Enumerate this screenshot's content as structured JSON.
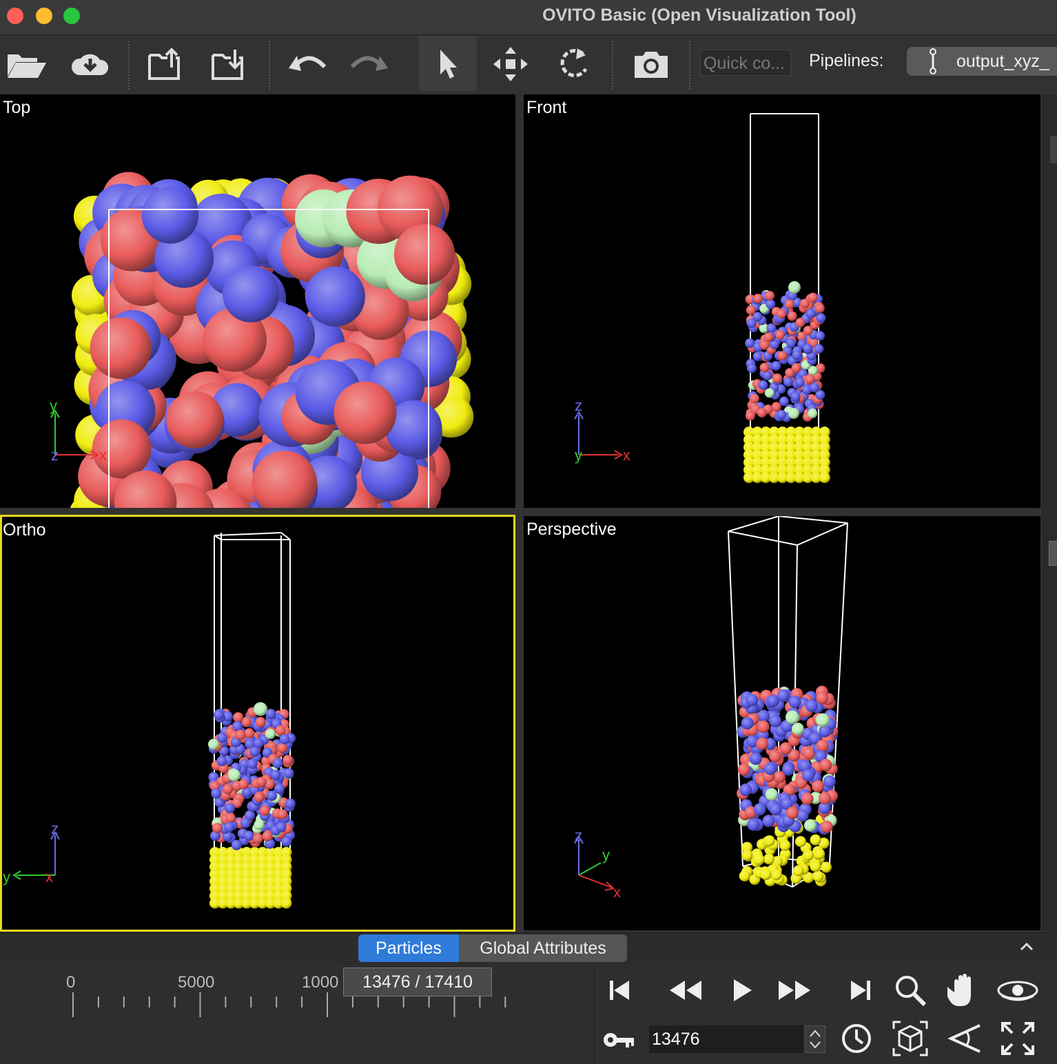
{
  "window": {
    "title": "OVITO Basic (Open Visualization Tool)"
  },
  "toolbar": {
    "quick_placeholder": "Quick co...",
    "pipelines_label": "Pipelines:",
    "pipeline_selected": "output_xyz_"
  },
  "viewports": {
    "top": "Top",
    "front": "Front",
    "ortho": "Ortho",
    "perspective": "Perspective"
  },
  "axes": {
    "x": "x",
    "y": "y",
    "z": "z"
  },
  "tabs": {
    "particles": "Particles",
    "global": "Global Attributes"
  },
  "timeline": {
    "ticks": [
      "0",
      "5000",
      "1000"
    ],
    "current": "13476 / 17410"
  },
  "animation": {
    "frame_value": "13476"
  },
  "colors": {
    "active_viewport": "#e6d81e",
    "tab_selected": "#2f7bd9",
    "atom_blue": "#5a5ae6",
    "atom_red": "#e85a5a",
    "atom_green": "#b8ecb4",
    "atom_yellow": "#f0ec10"
  }
}
